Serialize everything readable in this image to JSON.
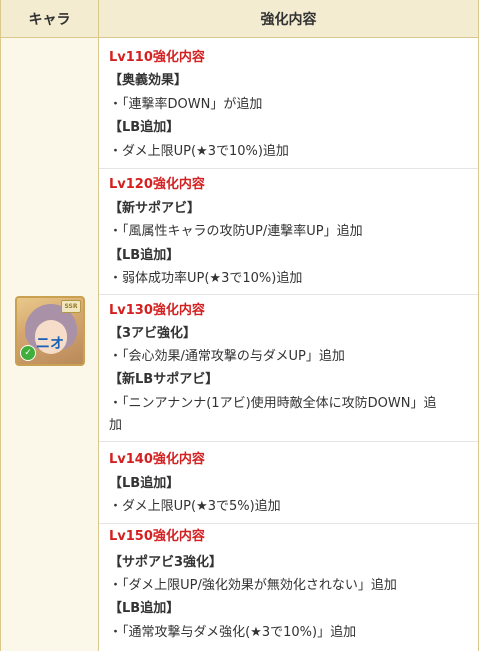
{
  "header": {
    "col_character": "キャラ",
    "col_content": "強化内容"
  },
  "character": {
    "name": "ニオ",
    "rarity": "SSR",
    "element_icon": "wind-element-icon",
    "portrait_icon": "character-portrait"
  },
  "sections": [
    {
      "level": "Lv110強化内容",
      "groups": [
        {
          "tag": "【奥義効果】",
          "items": [
            "・「連撃率DOWN」が追加"
          ]
        },
        {
          "tag": "【LB追加】",
          "items": [
            "・ダメ上限UP(★3で10%)追加"
          ]
        }
      ]
    },
    {
      "level": "Lv120強化内容",
      "groups": [
        {
          "tag": "【新サポアビ】",
          "items": [
            "・「風属性キャラの攻防UP/連撃率UP」追加"
          ]
        },
        {
          "tag": "【LB追加】",
          "items": [
            "・弱体成功率UP(★3で10%)追加"
          ]
        }
      ]
    },
    {
      "level": "Lv130強化内容",
      "groups": [
        {
          "tag": "【3アビ強化】",
          "items": [
            "・「会心効果/通常攻撃の与ダメUP」追加"
          ]
        },
        {
          "tag": "【新LBサポアビ】",
          "items": [
            "・「ニンアナンナ(1アビ)使用時敵全体に攻防DOWN」追",
            "加"
          ]
        }
      ]
    },
    {
      "level": "Lv140強化内容",
      "groups": [
        {
          "tag": "【LB追加】",
          "items": [
            "・ダメ上限UP(★3で5%)追加"
          ]
        }
      ]
    },
    {
      "level": "Lv150強化内容",
      "groups": [
        {
          "tag": "【サポアビ3強化】",
          "items": [
            "・「ダメ上限UP/強化効果が無効化されない」追加"
          ]
        },
        {
          "tag": "【LB追加】",
          "items": [
            "・「通常攻撃与ダメ強化(★3で10%)」追加"
          ]
        }
      ]
    }
  ],
  "colors": {
    "header_bg": "#f3ecd0",
    "border": "#d9c98c",
    "level_red": "#d42020",
    "name_blue": "#1a5fb4",
    "left_bg": "#fbf8ea"
  }
}
